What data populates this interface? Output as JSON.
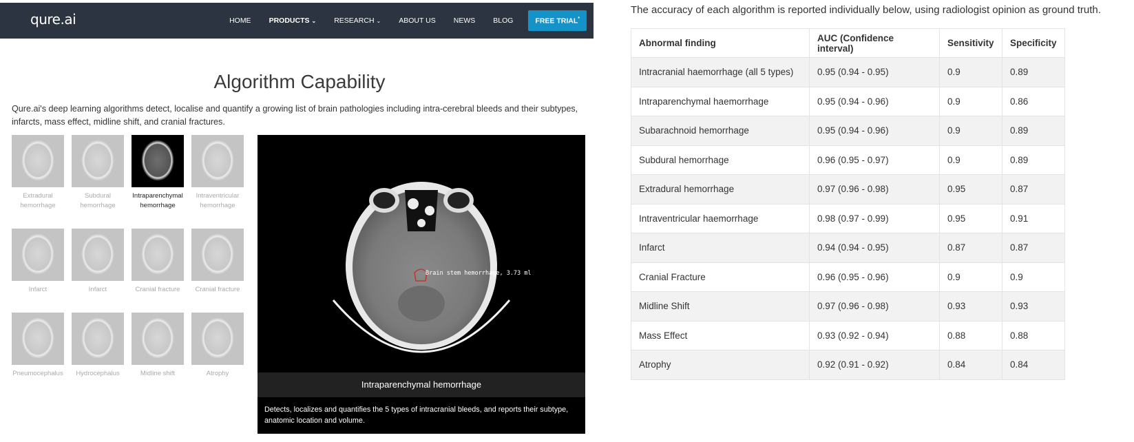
{
  "nav": {
    "logo": "qure.ai",
    "items": [
      {
        "label": "HOME",
        "bold": false,
        "caret": false
      },
      {
        "label": "PRODUCTS",
        "bold": true,
        "caret": true
      },
      {
        "label": "RESEARCH",
        "bold": false,
        "caret": true
      },
      {
        "label": "ABOUT US",
        "bold": false,
        "caret": false
      },
      {
        "label": "NEWS",
        "bold": false,
        "caret": false
      },
      {
        "label": "BLOG",
        "bold": false,
        "caret": false
      }
    ],
    "cta": "FREE TRIAL",
    "cta_sup": "*"
  },
  "page": {
    "title": "Algorithm Capability",
    "intro": "Qure.ai's deep learning algorithms detect, localise and quantify a growing list of brain pathologies including intra-cerebral bleeds and their subtypes, infarcts, mass effect, midline shift, and cranial fractures."
  },
  "thumbnails": [
    {
      "label": "Extradural hemorrhage",
      "active": false
    },
    {
      "label": "Subdural hemorrhage",
      "active": false
    },
    {
      "label": "Intraparenchymal hemorrhage",
      "active": true
    },
    {
      "label": "Intraventricular hemorrhage",
      "active": false
    },
    {
      "label": "Infarct",
      "active": false
    },
    {
      "label": "Infarct",
      "active": false
    },
    {
      "label": "Cranial fracture",
      "active": false
    },
    {
      "label": "Cranial fracture",
      "active": false
    },
    {
      "label": "Pneumocephalus",
      "active": false
    },
    {
      "label": "Hydrocephalus",
      "active": false
    },
    {
      "label": "Midline shift",
      "active": false
    },
    {
      "label": "Atrophy",
      "active": false
    }
  ],
  "viewer": {
    "annotation": "Brain stem hemorrhage, 3.73 ml",
    "caption": "Intraparenchymal hemorrhage",
    "description": "Detects, localizes and quantifies the 5 types of intracranial bleeds, and reports their subtype, anatomic location and volume."
  },
  "accuracy": {
    "intro": "The accuracy of each algorithm is reported individually below, using radiologist opinion as ground truth.",
    "headers": [
      "Abnormal finding",
      "AUC (Confidence interval)",
      "Sensitivity",
      "Specificity"
    ],
    "rows": [
      [
        "Intracranial haemorrhage (all 5 types)",
        "0.95 (0.94 - 0.95)",
        "0.9",
        "0.89"
      ],
      [
        "Intraparenchymal haemorrhage",
        "0.95 (0.94 - 0.96)",
        "0.9",
        "0.86"
      ],
      [
        "Subarachnoid hemorrhage",
        "0.95 (0.94 - 0.96)",
        "0.9",
        "0.89"
      ],
      [
        "Subdural hemorrhage",
        "0.96 (0.95 - 0.97)",
        "0.9",
        "0.89"
      ],
      [
        "Extradural hemorrhage",
        "0.97 (0.96 - 0.98)",
        "0.95",
        "0.87"
      ],
      [
        "Intraventricular haemorrhage",
        "0.98 (0.97 - 0.99)",
        "0.95",
        "0.91"
      ],
      [
        "Infarct",
        "0.94 (0.94 - 0.95)",
        "0.87",
        "0.87"
      ],
      [
        "Cranial Fracture",
        "0.96 (0.95 - 0.96)",
        "0.9",
        "0.9"
      ],
      [
        "Midline Shift",
        "0.97 (0.96 - 0.98)",
        "0.93",
        "0.93"
      ],
      [
        "Mass Effect",
        "0.93 (0.92 - 0.94)",
        "0.88",
        "0.88"
      ],
      [
        "Atrophy",
        "0.92 (0.91 - 0.92)",
        "0.84",
        "0.84"
      ]
    ]
  },
  "colors": {
    "navbar": "#2b3440",
    "cta": "#1493c9",
    "table_stripe": "#f2f2f2"
  }
}
